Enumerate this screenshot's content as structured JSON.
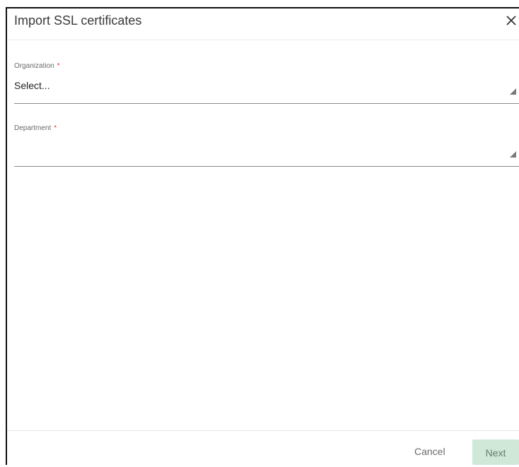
{
  "dialog": {
    "title": "Import SSL certificates",
    "close_icon": "close-icon"
  },
  "form": {
    "organization": {
      "label": "Organization",
      "required_mark": "*",
      "value": "Select..."
    },
    "department": {
      "label": "Department",
      "required_mark": "*",
      "value": ""
    }
  },
  "footer": {
    "cancel_label": "Cancel",
    "next_label": "Next"
  },
  "colors": {
    "required": "#e53935",
    "next_button_bg": "#cfe8d8",
    "next_button_text": "#5f7f6b"
  }
}
